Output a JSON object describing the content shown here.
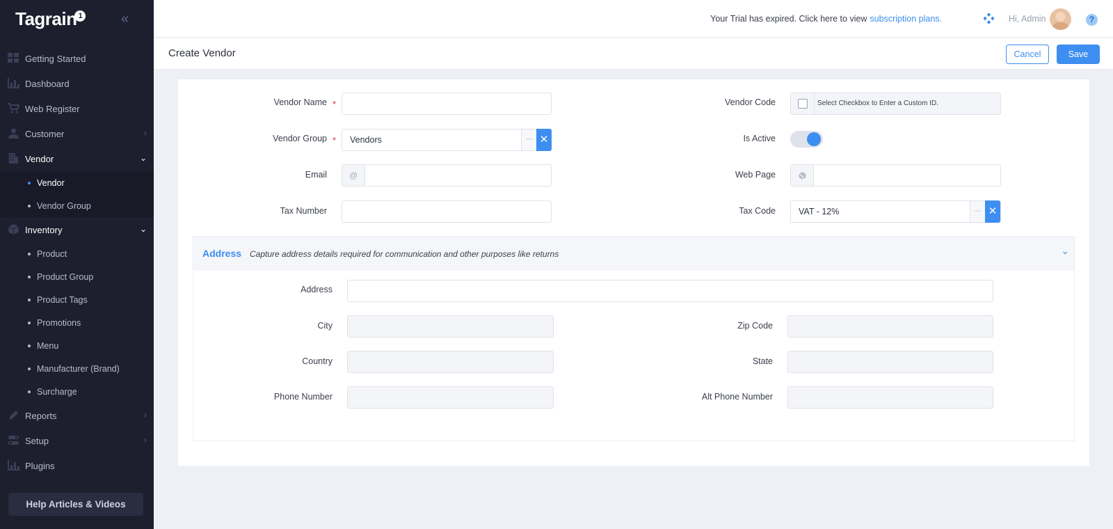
{
  "app": {
    "logo": "Tagrain",
    "logo_mark": "1"
  },
  "sidebar": {
    "collapse_icon": "«",
    "items": [
      {
        "label": "Getting Started",
        "icon": "grid-icon"
      },
      {
        "label": "Dashboard",
        "icon": "chart-icon"
      },
      {
        "label": "Web Register",
        "icon": "cart-icon"
      },
      {
        "label": "Customer",
        "icon": "user-icon"
      },
      {
        "label": "Vendor",
        "icon": "building-icon"
      },
      {
        "label": "Inventory",
        "icon": "box-icon"
      },
      {
        "label": "Reports",
        "icon": "pen-icon"
      },
      {
        "label": "Setup",
        "icon": "toggle-icon"
      },
      {
        "label": "Plugins",
        "icon": "chart-icon"
      }
    ],
    "vendor_sub": [
      "Vendor",
      "Vendor Group"
    ],
    "inventory_sub": [
      "Product",
      "Product Group",
      "Product Tags",
      "Promotions",
      "Menu",
      "Manufacturer (Brand)",
      "Surcharge"
    ],
    "help_button": "Help Articles & Videos"
  },
  "topbar": {
    "trial_text": "Your Trial has expired. Click here to view",
    "trial_link": "subscription plans.",
    "greeting": "Hi, Admin",
    "help_icon": "?"
  },
  "page": {
    "title": "Create Vendor",
    "cancel": "Cancel",
    "save": "Save"
  },
  "form": {
    "vendor_name_label": "Vendor Name",
    "vendor_group_label": "Vendor Group",
    "vendor_group_value": "Vendors",
    "email_label": "Email",
    "email_addon": "@",
    "tax_number_label": "Tax Number",
    "vendor_code_label": "Vendor Code",
    "vendor_code_checkbox_text": "Select Checkbox to Enter a Custom ID.",
    "is_active_label": "Is Active",
    "is_active": true,
    "web_page_label": "Web Page",
    "tax_code_label": "Tax Code",
    "tax_code_value": "VAT - 12%",
    "required_mark": "*",
    "more_glyph": "···",
    "clear_glyph": "✕"
  },
  "address": {
    "title": "Address",
    "description": "Capture address details required for communication and other purposes like returns",
    "address_label": "Address",
    "city_label": "City",
    "zip_label": "Zip Code",
    "country_label": "Country",
    "state_label": "State",
    "phone_label": "Phone Number",
    "alt_phone_label": "Alt Phone Number"
  },
  "colors": {
    "accent": "#3d8ef0",
    "sidebar_bg": "#1d1f2e",
    "required": "#e03131"
  }
}
